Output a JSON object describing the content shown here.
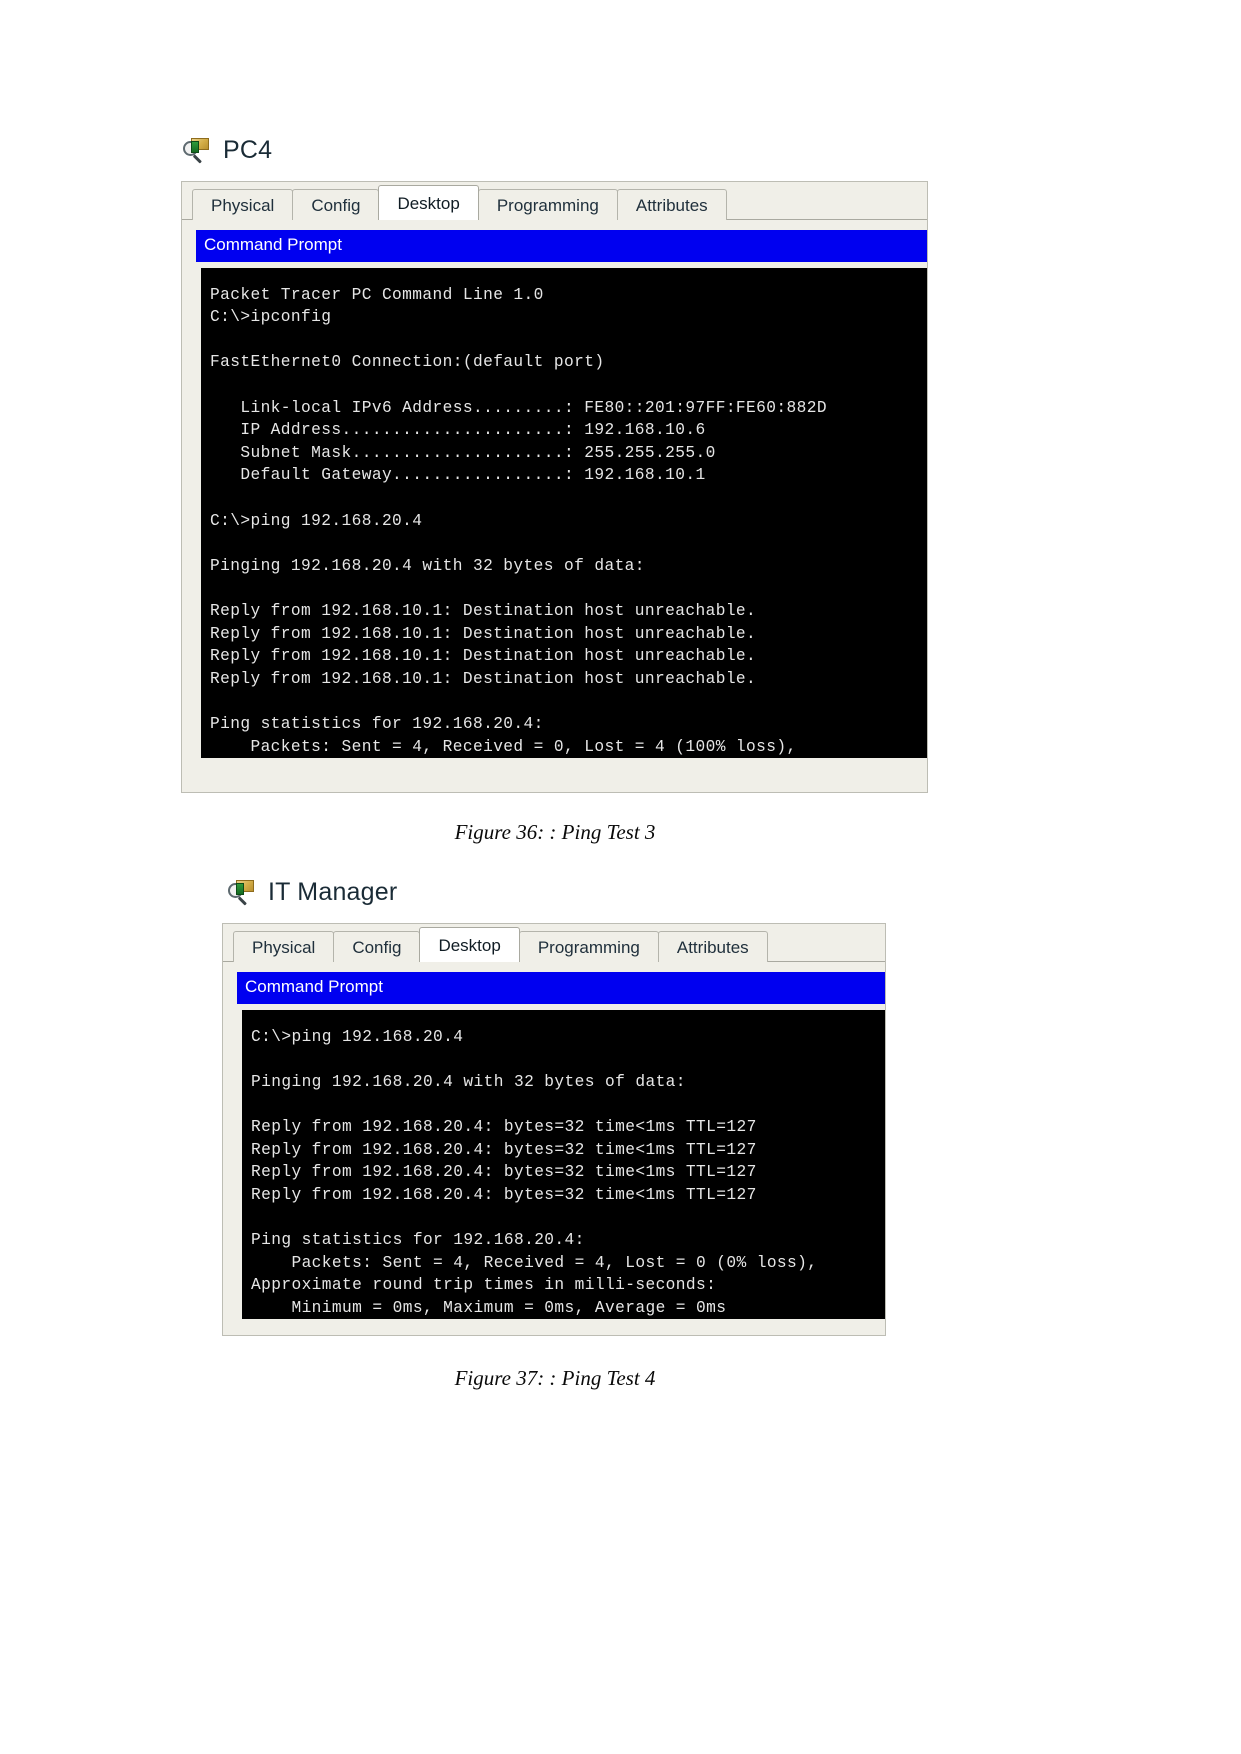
{
  "figures": [
    {
      "device_name": "PC4",
      "device_icon": "packet-tracer-pc-magnifier-icon",
      "tabs": [
        {
          "label": "Physical",
          "active": false
        },
        {
          "label": "Config",
          "active": false
        },
        {
          "label": "Desktop",
          "active": true
        },
        {
          "label": "Programming",
          "active": false
        },
        {
          "label": "Attributes",
          "active": false
        }
      ],
      "app_title": "Command Prompt",
      "console_lines": [
        "Packet Tracer PC Command Line 1.0",
        "C:\\>ipconfig",
        "",
        "FastEthernet0 Connection:(default port)",
        "",
        "   Link-local IPv6 Address.........: FE80::201:97FF:FE60:882D",
        "   IP Address......................: 192.168.10.6",
        "   Subnet Mask.....................: 255.255.255.0",
        "   Default Gateway.................: 192.168.10.1",
        "",
        "C:\\>ping 192.168.20.4",
        "",
        "Pinging 192.168.20.4 with 32 bytes of data:",
        "",
        "Reply from 192.168.10.1: Destination host unreachable.",
        "Reply from 192.168.10.1: Destination host unreachable.",
        "Reply from 192.168.10.1: Destination host unreachable.",
        "Reply from 192.168.10.1: Destination host unreachable.",
        "",
        "Ping statistics for 192.168.20.4:",
        "    Packets: Sent = 4, Received = 0, Lost = 4 (100% loss),"
      ],
      "caption": "Figure 36: : Ping Test 3"
    },
    {
      "device_name": "IT Manager",
      "device_icon": "packet-tracer-pc-magnifier-icon",
      "tabs": [
        {
          "label": "Physical",
          "active": false
        },
        {
          "label": "Config",
          "active": false
        },
        {
          "label": "Desktop",
          "active": true
        },
        {
          "label": "Programming",
          "active": false
        },
        {
          "label": "Attributes",
          "active": false
        }
      ],
      "app_title": "Command Prompt",
      "console_lines": [
        "C:\\>ping 192.168.20.4",
        "",
        "Pinging 192.168.20.4 with 32 bytes of data:",
        "",
        "Reply from 192.168.20.4: bytes=32 time<1ms TTL=127",
        "Reply from 192.168.20.4: bytes=32 time<1ms TTL=127",
        "Reply from 192.168.20.4: bytes=32 time<1ms TTL=127",
        "Reply from 192.168.20.4: bytes=32 time<1ms TTL=127",
        "",
        "Ping statistics for 192.168.20.4:",
        "    Packets: Sent = 4, Received = 4, Lost = 0 (0% loss),",
        "Approximate round trip times in milli-seconds:",
        "    Minimum = 0ms, Maximum = 0ms, Average = 0ms"
      ],
      "caption": "Figure 37: : Ping Test 4"
    }
  ],
  "colors": {
    "titlebar_blue": "#0000f0",
    "console_bg": "#000000",
    "console_fg": "#e6e6e6",
    "window_chrome": "#f0efe8"
  }
}
